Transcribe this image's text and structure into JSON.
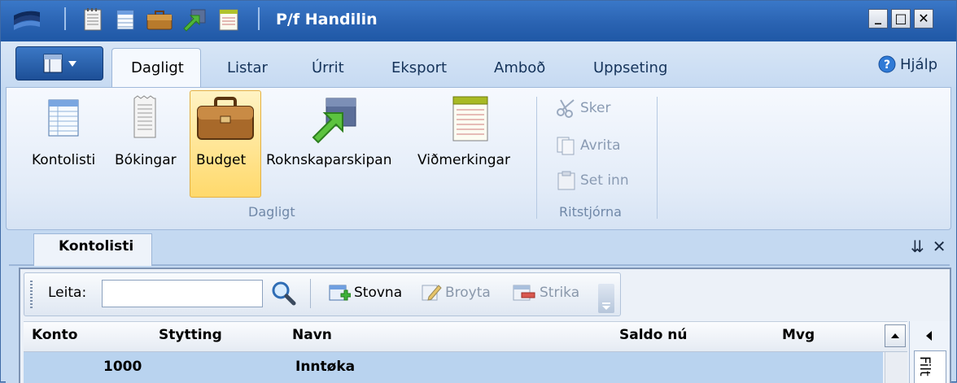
{
  "window": {
    "title": "P/f Handilin",
    "controls": {
      "minimize": "_",
      "maximize": "□",
      "close": "✕"
    }
  },
  "quick_access": [
    "window-logo-icon",
    "notepad-icon",
    "table-icon",
    "briefcase-icon",
    "export-icon",
    "notes-icon"
  ],
  "tabs": [
    {
      "label": "Dagligt",
      "active": true
    },
    {
      "label": "Listar"
    },
    {
      "label": "Úrrit"
    },
    {
      "label": "Eksport"
    },
    {
      "label": "Amboð"
    },
    {
      "label": "Uppseting"
    }
  ],
  "help": {
    "label": "Hjálp"
  },
  "ribbon": {
    "groups": [
      {
        "caption": "Dagligt",
        "buttons": [
          {
            "label": "Kontolisti",
            "icon": "account-list-icon"
          },
          {
            "label": "Bókingar",
            "icon": "bookings-icon"
          },
          {
            "label": "Budget",
            "icon": "briefcase-icon",
            "active": true
          },
          {
            "label": "Roknskaparskipan",
            "icon": "export-arrow-icon"
          },
          {
            "label": "Viðmerkingar",
            "icon": "notes-icon"
          }
        ]
      },
      {
        "caption": "Ritstjórna",
        "items": [
          {
            "label": "Sker",
            "icon": "scissors-icon",
            "enabled": false
          },
          {
            "label": "Avrita",
            "icon": "copy-icon",
            "enabled": false
          },
          {
            "label": "Set inn",
            "icon": "paste-icon",
            "enabled": false
          }
        ]
      }
    ]
  },
  "document": {
    "tab_label": "Kontolisti",
    "controls": {
      "pin": "⇊",
      "close": "✕"
    },
    "toolbar": {
      "search_label": "Leita:",
      "search_value": "",
      "buttons": [
        {
          "label": "Stovna",
          "enabled": true
        },
        {
          "label": "Broyta",
          "enabled": false
        },
        {
          "label": "Strika",
          "enabled": false
        }
      ]
    },
    "grid": {
      "columns": [
        "Konto",
        "Stytting",
        "Navn",
        "Saldo nú",
        "Mvg"
      ],
      "rows": [
        {
          "Konto": "1000",
          "Stytting": "",
          "Navn": "Inntøka",
          "Saldo nú": "",
          "Mvg": ""
        }
      ]
    },
    "side_panel": {
      "tab_label": "Filt"
    }
  }
}
